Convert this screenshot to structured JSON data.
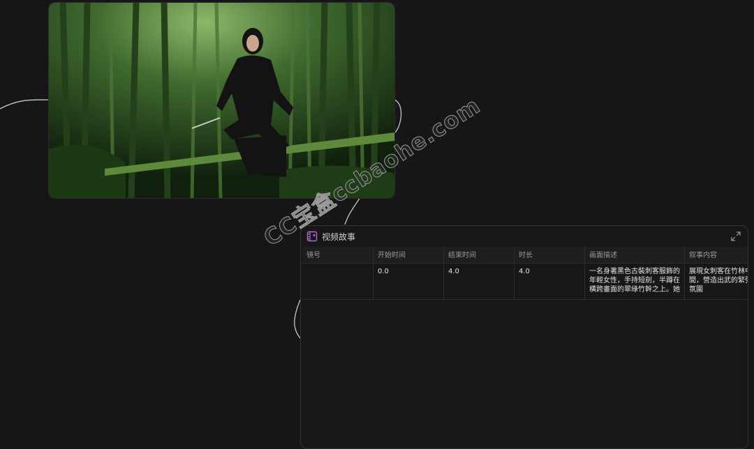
{
  "image_node": {
    "alt": "Woman in black ancient assassin attire crouching on a bamboo pole in a bamboo forest, holding a short sword",
    "colors": {
      "forest_dark": "#12240f",
      "forest_light": "#4d7a3a",
      "bamboo": "#5a7a3c",
      "figure": "#141414"
    }
  },
  "table_node": {
    "title": "视频故事",
    "icon": "film-icon",
    "expand_icon": "expand-icon",
    "columns": [
      "镜号",
      "开始时间",
      "结束时间",
      "时长",
      "画面描述",
      "叙事内容"
    ],
    "rows": [
      {
        "shot": "",
        "start": "0.0",
        "end": "4.0",
        "duration": "4.0",
        "description": "一名身著黑色古裝刺客服飾的年輕女性，手持短劍，半蹲在橫跨畫面的翠綠竹幹之上。她",
        "narrative": "展現女刺客在竹林中峙的瞬間，營造出武的緊張感與俠義氛圍"
      }
    ]
  },
  "watermark": "CC宝盒ccbaohe.com",
  "colors": {
    "background": "#161616",
    "accent_icon": "#b06ad6"
  }
}
